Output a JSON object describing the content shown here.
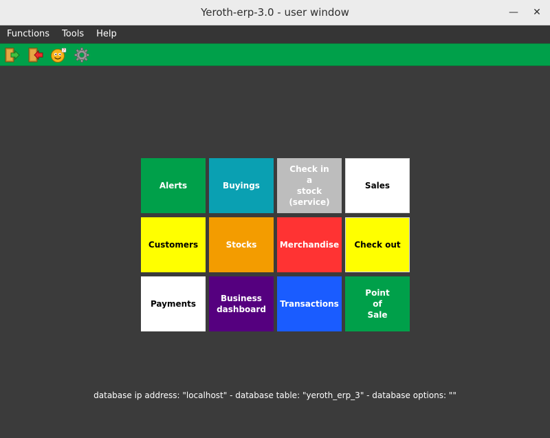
{
  "window": {
    "title": "Yeroth-erp-3.0 - user window",
    "minimize_glyph": "—",
    "close_glyph": "✕"
  },
  "menu": [
    "Functions",
    "Tools",
    "Help"
  ],
  "toolbar": {
    "background": "#00a04a",
    "icons": [
      "login-icon",
      "logout-icon",
      "smiley-face-icon",
      "settings-gear-icon"
    ]
  },
  "tiles": [
    {
      "label": "Alerts",
      "bg": "#00a04a",
      "fg": "#ffffff"
    },
    {
      "label": "Buyings",
      "bg": "#0aa0b2",
      "fg": "#ffffff"
    },
    {
      "label": "Check in\na\nstock (service)",
      "bg": "#bdbdbd",
      "fg": "#ffffff"
    },
    {
      "label": "Sales",
      "bg": "#ffffff",
      "fg": "#000000"
    },
    {
      "label": "Customers",
      "bg": "#ffff00",
      "fg": "#000000"
    },
    {
      "label": "Stocks",
      "bg": "#f39c00",
      "fg": "#ffffff"
    },
    {
      "label": "Merchandise",
      "bg": "#ff3333",
      "fg": "#ffffff"
    },
    {
      "label": "Check out",
      "bg": "#ffff00",
      "fg": "#000000"
    },
    {
      "label": "Payments",
      "bg": "#ffffff",
      "fg": "#000000"
    },
    {
      "label": "Business\ndashboard",
      "bg": "#55007f",
      "fg": "#ffffff"
    },
    {
      "label": "Transactions",
      "bg": "#1a5cff",
      "fg": "#ffffff"
    },
    {
      "label": "Point\nof\nSale",
      "bg": "#00a04a",
      "fg": "#ffffff"
    }
  ],
  "status": {
    "text": "database ip address: \"localhost\" - database table: \"yeroth_erp_3\" - database options: \"\""
  }
}
